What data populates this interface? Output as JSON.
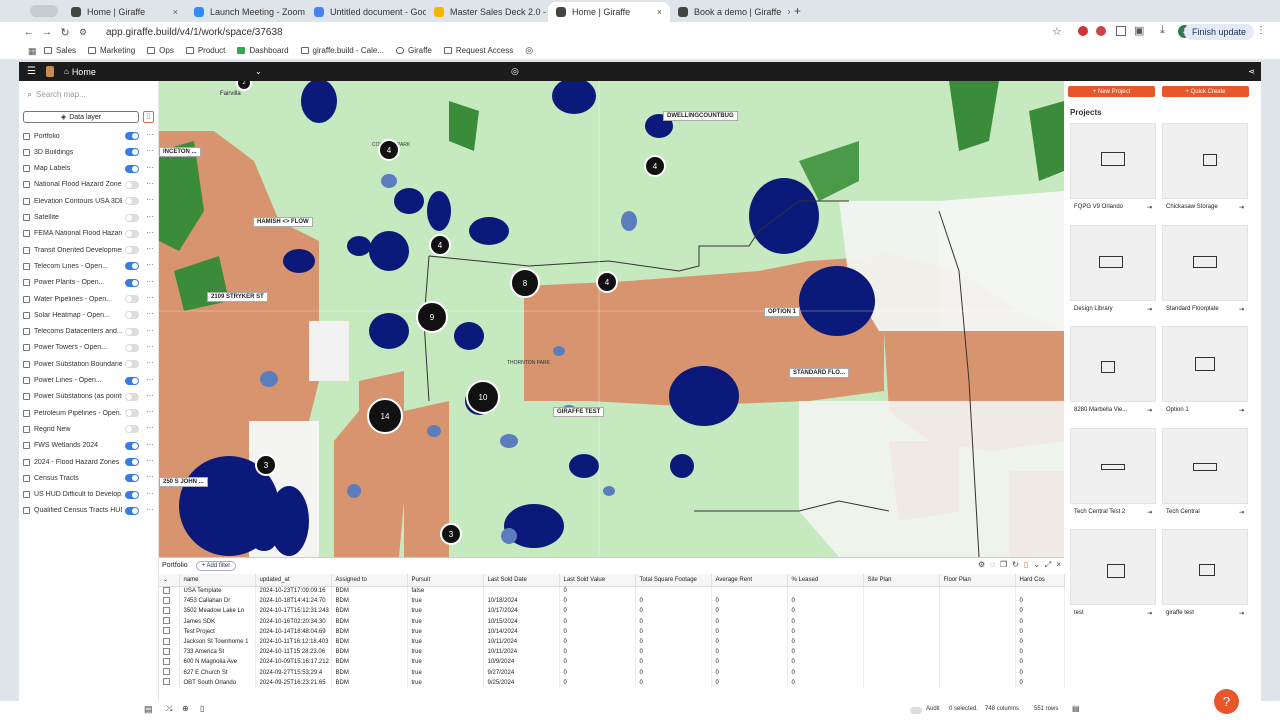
{
  "tabs": [
    {
      "label": "Home | Giraffe",
      "active": false
    },
    {
      "label": "Launch Meeting - Zoom",
      "active": false
    },
    {
      "label": "Untitled document - Google",
      "active": false
    },
    {
      "label": "Master Sales Deck 2.0 - Goo",
      "active": false
    },
    {
      "label": "Home | Giraffe",
      "active": true
    },
    {
      "label": "Book a demo | Giraffe",
      "active": false
    }
  ],
  "browser": {
    "url": "app.giraffe.build/v4/1/work/space/37638",
    "finish_update": "Finish update",
    "profile": "J"
  },
  "bookmarks": [
    "Sales",
    "Marketing",
    "Ops",
    "Product",
    "Dashboard",
    "giraffe.build - Cale...",
    "Giraffe",
    "Request Access"
  ],
  "app": {
    "title": "Home"
  },
  "sidebar": {
    "search_placeholder": "Search map...",
    "data_layer": "Data layer",
    "layers": [
      {
        "label": "Portfolio",
        "on": true
      },
      {
        "label": "3D Buildings",
        "on": true
      },
      {
        "label": "Map Labels",
        "on": true
      },
      {
        "label": "National Flood Hazard Zones...",
        "on": false
      },
      {
        "label": "Elevation Contours USA 3DEP",
        "on": false
      },
      {
        "label": "Satellite",
        "on": false
      },
      {
        "label": "FEMA National Flood Hazard...",
        "on": false
      },
      {
        "label": "Transit Oriented Development",
        "on": false
      },
      {
        "label": "Telecom Lines - Open...",
        "on": true
      },
      {
        "label": "Power Plants - Open...",
        "on": true
      },
      {
        "label": "Water Pipelines - Open...",
        "on": false
      },
      {
        "label": "Solar Heatmap - Open...",
        "on": false
      },
      {
        "label": "Telecoms Datacenters and...",
        "on": false
      },
      {
        "label": "Power Towers - Open...",
        "on": false
      },
      {
        "label": "Power Substation Boundarie...",
        "on": false
      },
      {
        "label": "Power Lines - Open...",
        "on": true
      },
      {
        "label": "Power Substations (as points...",
        "on": false
      },
      {
        "label": "Petroleum Pipelines - Open...",
        "on": false
      },
      {
        "label": "Regrid New",
        "on": false
      },
      {
        "label": "FWS Wetlands 2024",
        "on": true
      },
      {
        "label": "2024 - Flood Hazard Zones",
        "on": true
      },
      {
        "label": "Census Tracts",
        "on": true
      },
      {
        "label": "US HUD Difficult to Develop...",
        "on": true
      },
      {
        "label": "Qualified Census Tracts HUD",
        "on": true
      }
    ]
  },
  "map": {
    "labels": [
      "Fairvilla",
      "INCETON ...",
      "DWELLINGCOUNTBUG",
      "HAMISH <> FLOW",
      "2109 STRYKER ST",
      "OPTION 1",
      "STANDARD FLO...",
      "GIRAFFE TEST",
      "250 S JOHN ...",
      "COLLEGE PARK",
      "THORNTON PARK"
    ],
    "clusters": [
      "4",
      "4",
      "4",
      "8",
      "4",
      "9",
      "10",
      "14",
      "3",
      "3",
      "2"
    ]
  },
  "projects": {
    "new_project": "+ New Project",
    "quick_create": "+ Quick Create",
    "title": "Projects",
    "items": [
      "FQPG V9 Orlando",
      "Chickasaw Storage",
      "Design Library",
      "Standard Floorplate",
      "8280 Marbella Vie...",
      "Option 1",
      "Tech Central Test 2",
      "Tech Central",
      "test",
      "giraffe test"
    ]
  },
  "table": {
    "title": "Portfolio",
    "add_filter": "+ Add filter",
    "columns": [
      "name",
      "updated_at",
      "Assigned to",
      "Pursuit",
      "Last Sold Date",
      "Last Sold Value",
      "Total Square Footage",
      "Average Rent",
      "% Leased",
      "Site Plan",
      "Floor Plan",
      "Hard Cos"
    ],
    "rows": [
      [
        "USA Template",
        "2024-10-23T17:09:09.16",
        "BDM",
        "false",
        "",
        "0",
        "",
        "",
        "",
        "",
        "",
        ""
      ],
      [
        "7453 Callahan Dr",
        "2024-10-18T14:41:24.70",
        "BDM",
        "true",
        "10/18/2024",
        "0",
        "0",
        "0",
        "0",
        "",
        "",
        "0"
      ],
      [
        "3502 Meadow Lake Ln",
        "2024-10-17T15:12:31.243",
        "BDM",
        "true",
        "10/17/2024",
        "0",
        "0",
        "0",
        "0",
        "",
        "",
        "0"
      ],
      [
        "James SDK",
        "2024-10-16T02:20:34.30",
        "BDM",
        "true",
        "10/15/2024",
        "0",
        "0",
        "0",
        "0",
        "",
        "",
        "0"
      ],
      [
        "Test Project",
        "2024-10-14T18:48:04.69",
        "BDM",
        "true",
        "10/14/2024",
        "0",
        "0",
        "0",
        "0",
        "",
        "",
        "0"
      ],
      [
        "Jackson St Townhome 1",
        "2024-10-11T16:12:18.403",
        "BDM",
        "true",
        "10/11/2024",
        "0",
        "0",
        "0",
        "0",
        "",
        "",
        "0"
      ],
      [
        "733 America St",
        "2024-10-11T15:28:23.06",
        "BDM",
        "true",
        "10/11/2024",
        "0",
        "0",
        "0",
        "0",
        "",
        "",
        "0"
      ],
      [
        "600 N Magnolia Ave",
        "2024-10-09T15:16:17.212",
        "BDM",
        "true",
        "10/9/2024",
        "0",
        "0",
        "0",
        "0",
        "",
        "",
        "0"
      ],
      [
        "627 E Church St",
        "2024-09-27T15:53:29.4",
        "BDM",
        "true",
        "9/27/2024",
        "0",
        "0",
        "0",
        "0",
        "",
        "",
        "0"
      ],
      [
        "OBT South Orlando",
        "2024-09-25T16:23:21.65",
        "BDM",
        "true",
        "9/25/2024",
        "0",
        "0",
        "0",
        "0",
        "",
        "",
        "0"
      ]
    ]
  },
  "status": {
    "audit": "Audit",
    "selected": "0 selected.",
    "columns": "748 columns",
    "rows": "551 rows"
  }
}
